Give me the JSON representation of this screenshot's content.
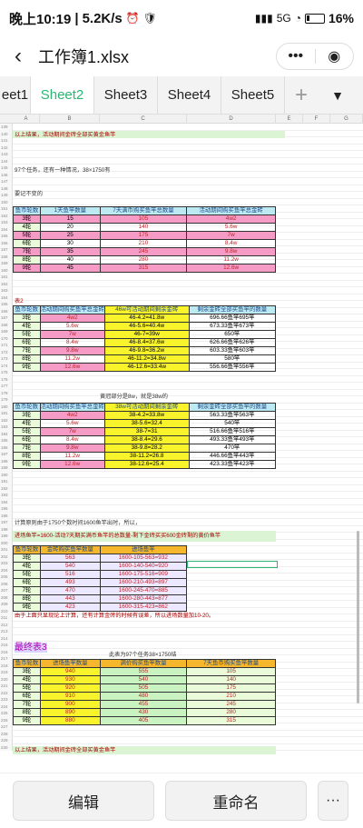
{
  "status": {
    "time": "晚上10:19",
    "speed": "5.2K/s",
    "network": "5G",
    "battery": "16%"
  },
  "titlebar": {
    "title": "工作簿1.xlsx",
    "more": "•••",
    "target": "◉"
  },
  "tabs": [
    {
      "label": "eet1",
      "active": false
    },
    {
      "label": "Sheet2",
      "active": true
    },
    {
      "label": "Sheet3",
      "active": false
    },
    {
      "label": "Sheet4",
      "active": false
    },
    {
      "label": "Sheet5",
      "active": false
    }
  ],
  "columns": [
    "A",
    "B",
    "C",
    "D",
    "E",
    "F",
    "G"
  ],
  "notes": {
    "r140": "以上结果，活动期间金砖全部买黄金鱼竿",
    "r145": "97个任务，还有一种情况，38×1750有",
    "r148": "要记不变的",
    "r160": "表2",
    "r171": "黄冠部分是8w，就是38w的",
    "r184": "计算原则由于1750个数时间1600鱼竿出时，所以，",
    "r185": "进场鱼竿=1600-活动7天期买满币鱼竿的总数量-剩下金砖买买600金砖剩的黄价鱼竿",
    "r198": "由于上面只显现论上计算，还有计算金砖的时候有误差，所以进场数量加10-20。",
    "r202": "最终表3",
    "r203": "此表为97个任务38×1750结",
    "r212": "以上结果，活动期间金砖全部买黄金鱼竿"
  },
  "table1": {
    "headers": [
      "鱼币轮数",
      "1天鱼竿数量",
      "7天满币购买鱼竿总数量",
      "活动期间购买鱼竿总金砖"
    ],
    "rows": [
      [
        "3轮",
        "15",
        "105",
        "4w2"
      ],
      [
        "4轮",
        "20",
        "140",
        "5.6w"
      ],
      [
        "5轮",
        "25",
        "175",
        "7w"
      ],
      [
        "6轮",
        "30",
        "210",
        "8.4w"
      ],
      [
        "7轮",
        "35",
        "245",
        "9.8w"
      ],
      [
        "8轮",
        "40",
        "280",
        "11.2w"
      ],
      [
        "9轮",
        "45",
        "315",
        "12.6w"
      ]
    ]
  },
  "table2": {
    "headers": [
      "鱼币轮数",
      "活动期间购买鱼竿总金砖",
      "46w可活动期间剩余金砖",
      "剩余金砖全部买鱼竿的数量"
    ],
    "rows": [
      [
        "3轮",
        "4w2",
        "46-4.2=41.8w",
        "696.66鱼竿695竿"
      ],
      [
        "4轮",
        "5.6w",
        "46-5.6=40.4w",
        "673.33鱼竿673竿"
      ],
      [
        "5轮",
        "7w",
        "46-7=39w",
        "650竿"
      ],
      [
        "6轮",
        "8.4w",
        "46-8.4=37.6w",
        "626.66鱼竿626竿"
      ],
      [
        "7轮",
        "9.8w",
        "46-9.8=36.2w",
        "603.33鱼竿603竿"
      ],
      [
        "8轮",
        "11.2w",
        "46-11.2=34.8w",
        "580竿"
      ],
      [
        "9轮",
        "12.6w",
        "46-12.6=33.4w",
        "556.66鱼竿556竿"
      ]
    ]
  },
  "table3": {
    "headers": [
      "鱼币轮数",
      "活动期间购买鱼竿总金砖",
      "38w可活动期间剩余金砖",
      "剩余金砖全部买鱼竿的数量"
    ],
    "rows": [
      [
        "3轮",
        "4w2",
        "38-4.2=33.8w",
        "563.33鱼竿563竿"
      ],
      [
        "4轮",
        "5.6w",
        "38-5.6=32.4",
        "540竿"
      ],
      [
        "5轮",
        "7w",
        "38-7=31",
        "516.66鱼竿516竿"
      ],
      [
        "6轮",
        "8.4w",
        "38-8.4=29.6",
        "493.33鱼竿493竿"
      ],
      [
        "7轮",
        "9.8w",
        "38-9.8=28.2",
        "470竿"
      ],
      [
        "8轮",
        "11.2w",
        "38-11.2=26.8",
        "446.66鱼竿443竿"
      ],
      [
        "9轮",
        "12.6w",
        "38-12.6=25.4",
        "423.33鱼竿423竿"
      ]
    ]
  },
  "table4": {
    "headers": [
      "鱼币轮数",
      "金砖购买鱼竿数量",
      "进场鱼竿"
    ],
    "rows": [
      [
        "3轮",
        "563",
        "1600-105-563=932"
      ],
      [
        "4轮",
        "540",
        "1600-140-540=920"
      ],
      [
        "5轮",
        "516",
        "1600-175-516=909"
      ],
      [
        "6轮",
        "493",
        "1600-210-493=897"
      ],
      [
        "7轮",
        "470",
        "1600-245-470=885"
      ],
      [
        "8轮",
        "443",
        "1600-280-443=877"
      ],
      [
        "9轮",
        "423",
        "1600-315-423=862"
      ]
    ]
  },
  "table5": {
    "headers": [
      "鱼币轮数",
      "进场鱼竿数量",
      "满价购买鱼竿数量",
      "7天鱼币购买鱼竿数量"
    ],
    "rows": [
      [
        "3轮",
        "940",
        "555",
        "105"
      ],
      [
        "4轮",
        "930",
        "540",
        "140"
      ],
      [
        "5轮",
        "920",
        "505",
        "175"
      ],
      [
        "6轮",
        "910",
        "480",
        "210"
      ],
      [
        "7轮",
        "900",
        "455",
        "245"
      ],
      [
        "8轮",
        "890",
        "430",
        "280"
      ],
      [
        "9轮",
        "880",
        "405",
        "315"
      ]
    ]
  },
  "bottom": {
    "edit": "编辑",
    "rename": "重命名",
    "more": "···"
  }
}
